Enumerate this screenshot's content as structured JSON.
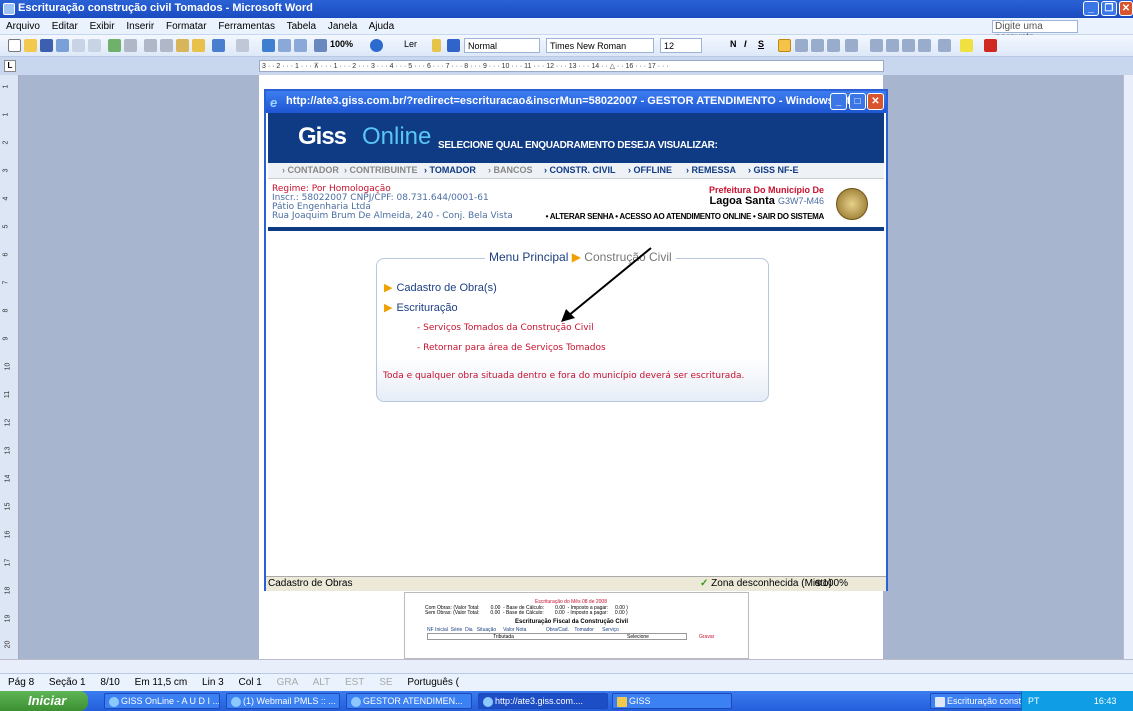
{
  "word": {
    "title": "Escrituração construção civil Tomados - Microsoft Word",
    "menu": [
      "Arquivo",
      "Editar",
      "Exibir",
      "Inserir",
      "Formatar",
      "Ferramentas",
      "Tabela",
      "Janela",
      "Ajuda"
    ],
    "help_placeholder": "Digite uma pergunta",
    "toolbar": {
      "zoom": "100%",
      "read": "Ler",
      "style": "Normal",
      "font": "Times New Roman",
      "size": "12"
    },
    "ruler_text": "3 · · 2 · · · 1 · · · ⊼ · · · 1 · · · 2 · · · 3 · · · 4 · · · 5 · · · 6 · · · 7 · · · 8 · · · 9 · · · 10 · · · 11 · · · 12 · · · 13 · · · 14 · · △ · · 16 · · · 17 · · ·",
    "vruler": [
      "1",
      "1",
      "2",
      "3",
      "4",
      "5",
      "6",
      "7",
      "8",
      "9",
      "10",
      "11",
      "12",
      "13",
      "14",
      "15",
      "16",
      "17",
      "18",
      "19",
      "20"
    ],
    "status": {
      "page": "Pág 8",
      "section": "Seção 1",
      "pages": "8/10",
      "position": "Em 11,5 cm",
      "line": "Lin 3",
      "col": "Col 1",
      "gra": "GRA",
      "alt": "ALT",
      "est": "EST",
      "se": "SE",
      "lang": "Português ("
    }
  },
  "ie": {
    "title": "http://ate3.giss.com.br/?redirect=escrituracao&inscrMun=58022007 - GESTOR ATENDIMENTO - Windows Int...",
    "status_left": "Cadastro de Obras",
    "status_zone": "Zona desconhecida (Misto)",
    "status_zoom": "100%"
  },
  "giss": {
    "logo_a": "Giss",
    "logo_b": "Online",
    "subtitle": "SELECIONE QUAL ENQUADRAMENTO DESEJA VISUALIZAR:",
    "nav": [
      "› CONTADOR",
      "› CONTRIBUINTE",
      "› TOMADOR",
      "› BANCOS",
      "› CONSTR. CIVIL",
      "› OFFLINE",
      "› REMESSA",
      "› GISS NF-E"
    ],
    "regime": "Regime: Por Homologação",
    "inscr": "Inscr.: 58022007   CNPJ/CPF: 08.731.644/0001-61",
    "company": "Pátio Engenharia Ltda",
    "address": "Rua Joaquim Brum De Almeida, 240 - Conj. Bela Vista",
    "pref_title": "Prefeitura Do Município De",
    "pref_city": "Lagoa Santa",
    "pref_code": "G3W7-M46",
    "pref_links": "• ALTERAR SENHA • ACESSO AO ATENDIMENTO ONLINE • SAIR DO SISTEMA",
    "menu_title": "Menu Principal",
    "menu_crumb": "Construção Civil",
    "link_cadastro": "Cadastro de Obra(s)",
    "link_escrituracao": "Escrituração",
    "sub1": "- Serviços Tomados da Construção Civil",
    "sub2": "- Retornar para área de Serviços Tomados",
    "notice": "Toda e qualquer obra situada dentro e fora do município deverá ser escriturada."
  },
  "snippet": {
    "line1": "Escrituração do Mês 08 de 2008",
    "line2": "Com Obras: (Valor Total:        0.00  - Base de Cálculo:        0.00  - Imposto a pagar:     0.00 )",
    "line3": "Sem Obras: (Valor Total:        0.00  - Base de Cálculo:        0.00  - Imposto a pagar:     0.00 )",
    "line4": "Escrituração Fiscal da Construção Civil",
    "cols": "NF Inicial  Série  Dia   Situação     Valor Nota              Obra/Cad.    Tomador      Serviço",
    "sel1": "Tributada",
    "sel2": "Selecione",
    "gravar": "Gravar"
  },
  "taskbar": {
    "start": "Iniciar",
    "tasks": [
      "GISS OnLine - A U D I ...",
      "(1) Webmail PMLS :: ...",
      "GESTOR ATENDIMEN...",
      "http://ate3.giss.com....",
      "GISS",
      "Escrituração construç..."
    ],
    "lang": "PT",
    "time": "16:43"
  }
}
